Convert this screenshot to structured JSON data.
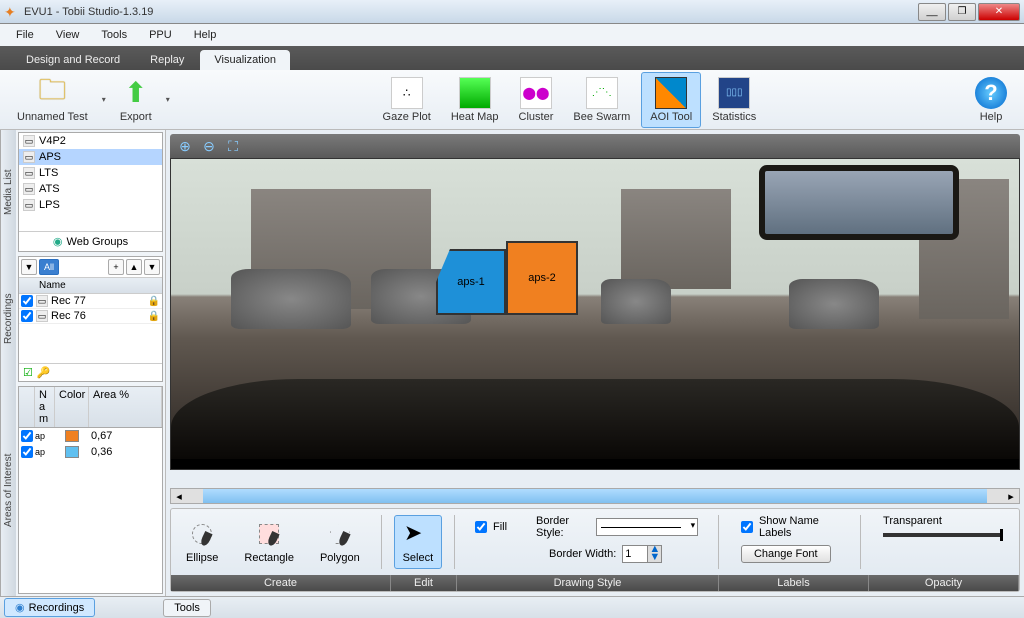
{
  "title": "EVU1 - Tobii Studio-1.3.19",
  "menu": [
    "File",
    "View",
    "Tools",
    "PPU",
    "Help"
  ],
  "tabs": [
    {
      "label": "Design and Record",
      "active": false
    },
    {
      "label": "Replay",
      "active": false
    },
    {
      "label": "Visualization",
      "active": true
    }
  ],
  "toolbar": {
    "unnamed": "Unnamed Test",
    "export": "Export",
    "tools": [
      {
        "label": "Gaze Plot"
      },
      {
        "label": "Heat Map"
      },
      {
        "label": "Cluster"
      },
      {
        "label": "Bee Swarm"
      },
      {
        "label": "AOI Tool",
        "selected": true
      },
      {
        "label": "Statistics"
      }
    ],
    "help": "Help"
  },
  "sidebar": {
    "media_label": "Media List",
    "media": [
      "V4P2",
      "APS",
      "LTS",
      "ATS",
      "LPS"
    ],
    "media_selected": "APS",
    "web_groups": "Web Groups",
    "rec_label": "Recordings",
    "rec_filter": "All",
    "rec_name_header": "Name",
    "recordings": [
      "Rec 77",
      "Rec 76"
    ],
    "aoi_label": "Areas of Interest",
    "aoi_headers": {
      "name": "N\na\nm",
      "color": "Color",
      "area": "Area %"
    },
    "aois": [
      {
        "name": "ap",
        "color": "#f08020",
        "area": "0,67"
      },
      {
        "name": "ap",
        "color": "#60c0f0",
        "area": "0,36"
      }
    ]
  },
  "scene": {
    "aoi1": "aps-1",
    "aoi2": "aps-2"
  },
  "bottom": {
    "create_label": "Create",
    "edit_label": "Edit",
    "style_label": "Drawing Style",
    "labels_label": "Labels",
    "opacity_label": "Opacity",
    "shapes": [
      "Ellipse",
      "Rectangle",
      "Polygon"
    ],
    "select": "Select",
    "fill": "Fill",
    "border_style": "Border Style:",
    "border_width": "Border Width:",
    "border_width_val": "1",
    "show_labels": "Show Name Labels",
    "change_font": "Change Font",
    "transparent": "Transparent"
  },
  "footer": {
    "recordings": "Recordings",
    "tools": "Tools"
  }
}
